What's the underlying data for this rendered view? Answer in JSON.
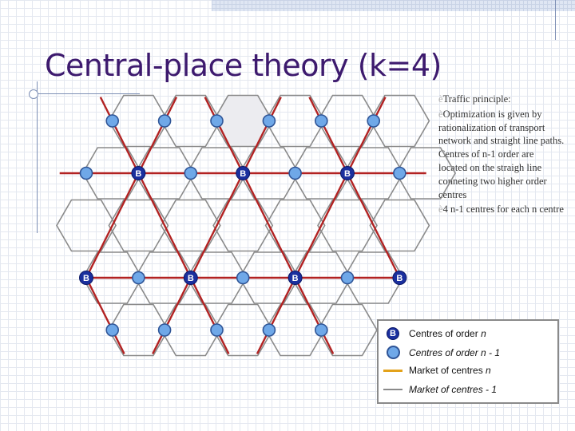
{
  "slide": {
    "title": "Central-place theory (k=4)",
    "bullets": [
      "Traffic principle:",
      "Optimization is given by rationalization of transport network and straight line paths. Centres of n-1 order are located on the straigh line conneting two higher order centres",
      "4 n-1 centres for each n centre"
    ],
    "bullet_marker": "è"
  },
  "diagram": {
    "hex_centers": [
      [
        2,
        1
      ],
      [
        4,
        1
      ],
      [
        6,
        1
      ],
      [
        8,
        1
      ],
      [
        10,
        1
      ],
      [
        12,
        1
      ],
      [
        1,
        2
      ],
      [
        3,
        2
      ],
      [
        5,
        2
      ],
      [
        7,
        2
      ],
      [
        9,
        2
      ],
      [
        11,
        2
      ],
      [
        13,
        2
      ],
      [
        0,
        3
      ],
      [
        2,
        3
      ],
      [
        4,
        3
      ],
      [
        6,
        3
      ],
      [
        8,
        3
      ],
      [
        10,
        3
      ],
      [
        12,
        3
      ],
      [
        1,
        4
      ],
      [
        3,
        4
      ],
      [
        5,
        4
      ],
      [
        7,
        4
      ],
      [
        9,
        4
      ],
      [
        11,
        4
      ],
      [
        2,
        5
      ],
      [
        4,
        5
      ],
      [
        6,
        5
      ],
      [
        8,
        5
      ],
      [
        10,
        5
      ]
    ],
    "highlighted_hex": [
      6,
      1
    ],
    "order_n_centres": [
      [
        2,
        2
      ],
      [
        6,
        2
      ],
      [
        10,
        2
      ],
      [
        0,
        4
      ],
      [
        4,
        4
      ],
      [
        8,
        4
      ],
      [
        12,
        4
      ]
    ],
    "order_n1_centres": [
      [
        1,
        1
      ],
      [
        3,
        1
      ],
      [
        5,
        1
      ],
      [
        7,
        1
      ],
      [
        9,
        1
      ],
      [
        11,
        1
      ],
      [
        0,
        2
      ],
      [
        4,
        2
      ],
      [
        8,
        2
      ],
      [
        12,
        2
      ],
      [
        2,
        4
      ],
      [
        6,
        4
      ],
      [
        10,
        4
      ],
      [
        1,
        5
      ],
      [
        3,
        5
      ],
      [
        5,
        5
      ],
      [
        7,
        5
      ],
      [
        9,
        5
      ]
    ],
    "centre_label": "B",
    "colors": {
      "market_n": "#b22222",
      "market_n1": "#8a8a8a",
      "highlight_fill": "#ececf0",
      "centre_n_fill": "#1a2f9e",
      "centre_n1_fill": "#6fa8e8",
      "centre_n1_stroke": "#2f5597"
    }
  },
  "legend": {
    "items": [
      {
        "symbol": "B",
        "label": "Centres of order",
        "italic_suffix": "n"
      },
      {
        "symbol": "",
        "label": "Centres of order n - 1"
      },
      {
        "symbol": "",
        "label": "Market of centres",
        "italic_suffix": "n"
      },
      {
        "symbol": "",
        "label": "Market of centres  - 1"
      }
    ]
  }
}
